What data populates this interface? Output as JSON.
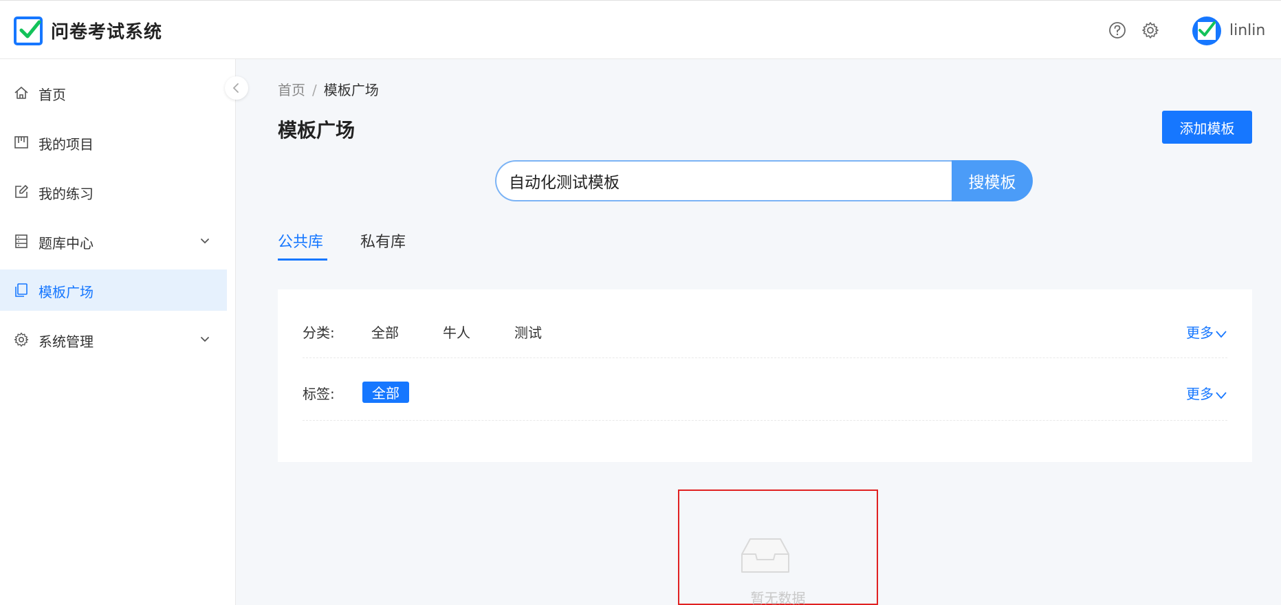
{
  "app": {
    "title": "问卷考试系统",
    "username": "linlin"
  },
  "header": {
    "help_icon": "question-circle-icon",
    "settings_icon": "gear-icon"
  },
  "sidebar": {
    "items": [
      {
        "label": "首页",
        "icon": "home-icon",
        "expandable": false,
        "active": false
      },
      {
        "label": "我的项目",
        "icon": "project-board-icon",
        "expandable": false,
        "active": false
      },
      {
        "label": "我的练习",
        "icon": "edit-icon",
        "expandable": false,
        "active": false
      },
      {
        "label": "题库中心",
        "icon": "database-icon",
        "expandable": true,
        "active": false
      },
      {
        "label": "模板广场",
        "icon": "copy-icon",
        "expandable": false,
        "active": true
      },
      {
        "label": "系统管理",
        "icon": "gear-icon",
        "expandable": true,
        "active": false
      }
    ]
  },
  "breadcrumb": {
    "home": "首页",
    "separator": "/",
    "current": "模板广场"
  },
  "page": {
    "title": "模板广场",
    "add_button": "添加模板"
  },
  "search": {
    "value": "自动化测试模板",
    "button": "搜模板"
  },
  "tabs": [
    {
      "label": "公共库",
      "active": true
    },
    {
      "label": "私有库",
      "active": false
    }
  ],
  "filters": {
    "category": {
      "label": "分类:",
      "options": [
        "全部",
        "牛人",
        "测试"
      ],
      "more": "更多"
    },
    "tag": {
      "label": "标签:",
      "selected": "全部",
      "more": "更多"
    }
  },
  "empty": {
    "text": "暂无数据",
    "icon": "inbox-icon"
  },
  "colors": {
    "primary": "#1677ff",
    "active_bg": "#e6f1fd",
    "highlight_border": "#e02020"
  }
}
